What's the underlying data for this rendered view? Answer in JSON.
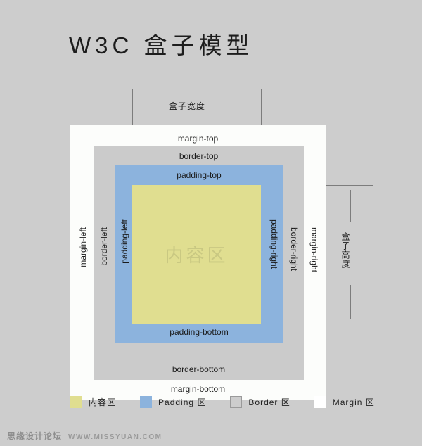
{
  "page": {
    "title": "W3C 盒子模型",
    "background_color": "#cdcdcd"
  },
  "measurements": {
    "width_label": "盒子宽度",
    "height_label": "盒子高度"
  },
  "box_model": {
    "margin": {
      "top_label": "margin-top",
      "bottom_label": "margin-bottom",
      "left_label": "margin-left",
      "right_label": "margin-right",
      "color": "#fcfdfb"
    },
    "border": {
      "top_label": "border-top",
      "bottom_label": "border-bottom",
      "left_label": "border-left",
      "right_label": "border-right",
      "color": "#cbcbcb"
    },
    "padding": {
      "top_label": "padding-top",
      "bottom_label": "padding-bottom",
      "left_label": "padding-left",
      "right_label": "padding-right",
      "color": "#8cb3dd"
    },
    "content": {
      "label": "内容区",
      "color": "#e0de90"
    }
  },
  "legend": {
    "items": [
      {
        "label": "内容区",
        "color": "#e0de90"
      },
      {
        "label": "Padding 区",
        "color": "#8cb3dd"
      },
      {
        "label": "Border 区",
        "color": "#cdcdcd"
      },
      {
        "label": "Margin 区",
        "color": "#ffffff"
      }
    ]
  },
  "watermark": {
    "site_cn": "思缘设计论坛",
    "site_url": "WWW.MISSYUAN.COM"
  }
}
